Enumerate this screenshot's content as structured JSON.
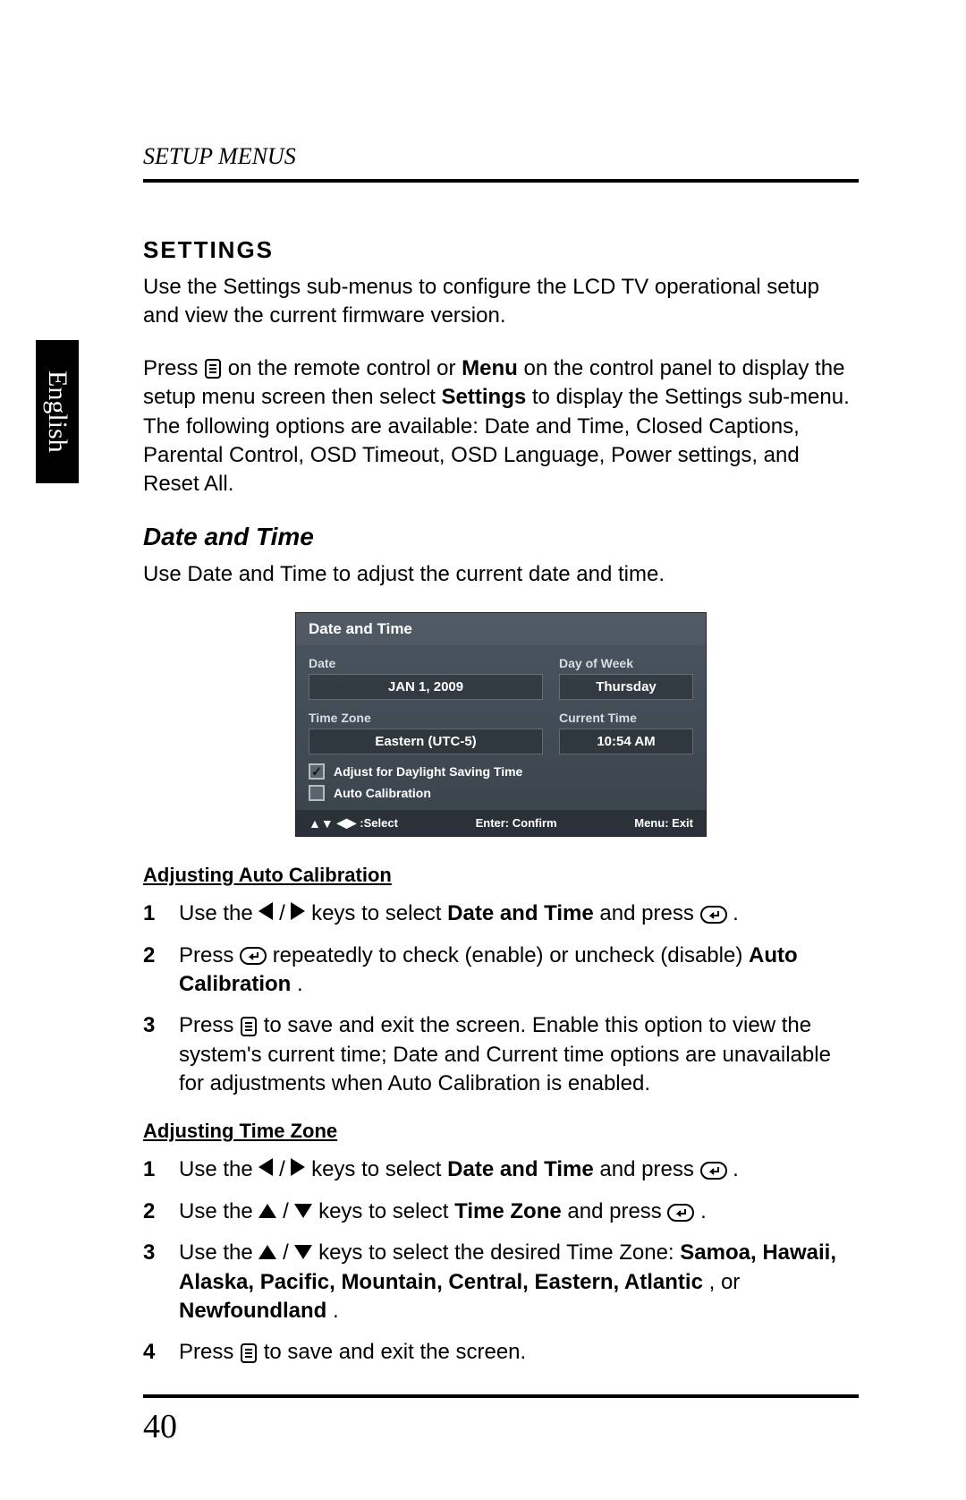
{
  "runningHead": "SETUP MENUS",
  "sidebarLabel": "English",
  "settingsHeading": "SETTINGS",
  "settingsPara1": "Use the Settings sub-menus to configure the LCD TV operational setup and view the current firmware version.",
  "settingsPara2_pre": "Press ",
  "settingsPara2_mid1": " on the remote control or ",
  "settingsPara2_menu": "Menu",
  "settingsPara2_mid2": " on the control panel to display the setup menu screen then select ",
  "settingsPara2_settings": "Settings",
  "settingsPara2_post": " to display the Settings sub-menu. The following options are available: Date and Time, Closed Captions, Parental Control, OSD Timeout, OSD Language, Power settings, and Reset All.",
  "dateTimeHeading": "Date and Time",
  "dateTimeIntro": "Use Date and Time to adjust the current date and time.",
  "osd": {
    "title": "Date and Time",
    "dateLabel": "Date",
    "dateValue": "JAN 1, 2009",
    "dayLabel": "Day of Week",
    "dayValue": "Thursday",
    "tzLabel": "Time Zone",
    "tzValue": "Eastern (UTC-5)",
    "curTimeLabel": "Current Time",
    "curTimeValue": "10:54 AM",
    "dstLabel": "Adjust for Daylight Saving Time",
    "autoCalLabel": "Auto Calibration",
    "footSelect": ":Select",
    "footEnter": "Enter: Confirm",
    "footMenu": "Menu: Exit"
  },
  "sub1": "Adjusting Auto Calibration",
  "s1_1a": "Use the ",
  "s1_1b": " keys to select ",
  "s1_1_dt": "Date and Time",
  "s1_1c": " and press ",
  "s1_1d": ".",
  "s1_2a": "Press ",
  "s1_2b": " repeatedly to check (enable) or uncheck (disable) ",
  "s1_2_ac": "Auto Calibration",
  "s1_2c": ".",
  "s1_3a": "Press ",
  "s1_3b": " to save and exit the screen. Enable this option to view the system's current time; Date and Current time options are unavailable for adjustments when Auto Calibration is enabled.",
  "sub2": "Adjusting Time Zone",
  "s2_1a": "Use the ",
  "s2_1b": " keys to select ",
  "s2_1_dt": "Date and Time",
  "s2_1c": " and press ",
  "s2_1d": ".",
  "s2_2a": "Use the ",
  "s2_2b": " keys to select ",
  "s2_2_tz": "Time Zone",
  "s2_2c": " and press ",
  "s2_2d": ".",
  "s2_3a": "Use the ",
  "s2_3b": " keys to select the desired Time Zone: ",
  "s2_3_list": "Samoa, Hawaii, Alaska, Pacific, Mountain, Central, Eastern, Atlantic",
  "s2_3_or": ", or ",
  "s2_3_nf": "Newfoundland",
  "s2_3c": ".",
  "s2_4a": "Press ",
  "s2_4b": " to save and exit the screen.",
  "slash": " / ",
  "pageNumber": "40"
}
